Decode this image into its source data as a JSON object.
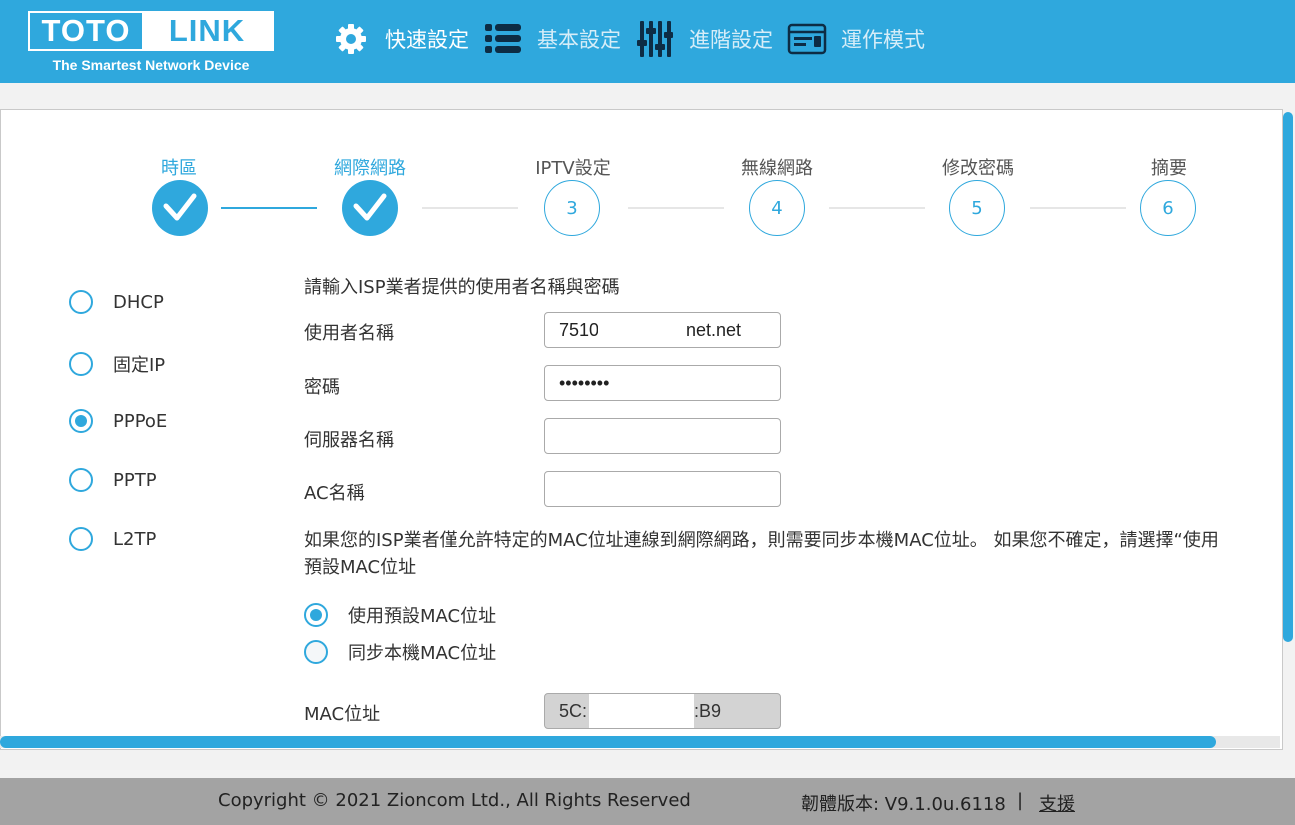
{
  "brand": {
    "logo_left": "TOTO",
    "logo_right": "LINK",
    "tagline": "The Smartest Network Device"
  },
  "nav": [
    {
      "label": "快速設定",
      "icon": "gear-icon",
      "active": true
    },
    {
      "label": "基本設定",
      "icon": "list-icon",
      "active": false
    },
    {
      "label": "進階設定",
      "icon": "sliders-icon",
      "active": false
    },
    {
      "label": "運作模式",
      "icon": "mode-icon",
      "active": false
    }
  ],
  "steps": [
    {
      "label": "時區",
      "number": "1",
      "done": true
    },
    {
      "label": "網際網路",
      "number": "2",
      "done": true
    },
    {
      "label": "IPTV設定",
      "number": "3",
      "done": false
    },
    {
      "label": "無線網路",
      "number": "4",
      "done": false
    },
    {
      "label": "修改密碼",
      "number": "5",
      "done": false
    },
    {
      "label": "摘要",
      "number": "6",
      "done": false
    }
  ],
  "connection_types": [
    {
      "label": "DHCP",
      "selected": false
    },
    {
      "label": "固定IP",
      "selected": false
    },
    {
      "label": "PPPoE",
      "selected": true
    },
    {
      "label": "PPTP",
      "selected": false
    },
    {
      "label": "L2TP",
      "selected": false
    }
  ],
  "form": {
    "intro": "請輸入ISP業者提供的使用者名稱與密碼",
    "username_label": "使用者名稱",
    "username_value_start": "7510",
    "username_value_end": "net.net",
    "password_label": "密碼",
    "password_value": "••••••••",
    "service_label": "伺服器名稱",
    "service_value": "",
    "ac_label": "AC名稱",
    "ac_value": "",
    "mac_note_line1": "如果您的ISP業者僅允許特定的MAC位址連線到網際網路，則需要同步本機MAC位址。 如果您不確定，請選擇“使用",
    "mac_note_line2": "預設MAC位址",
    "mac_options": [
      {
        "label": "使用預設MAC位址",
        "selected": true
      },
      {
        "label": "同步本機MAC位址",
        "selected": false
      }
    ],
    "mac_label": "MAC位址",
    "mac_value_start": "5C:",
    "mac_value_end": ":B9"
  },
  "footer": {
    "copyright": "Copyright © 2021 Zioncom Ltd., All Rights Reserved",
    "firmware": "韌體版本: V9.1.0u.6118",
    "separator": "|",
    "support": "支援"
  },
  "colors": {
    "accent": "#2fa8dd",
    "footer_bg": "#a3a3a3",
    "page_bg": "#f2f2f2"
  }
}
